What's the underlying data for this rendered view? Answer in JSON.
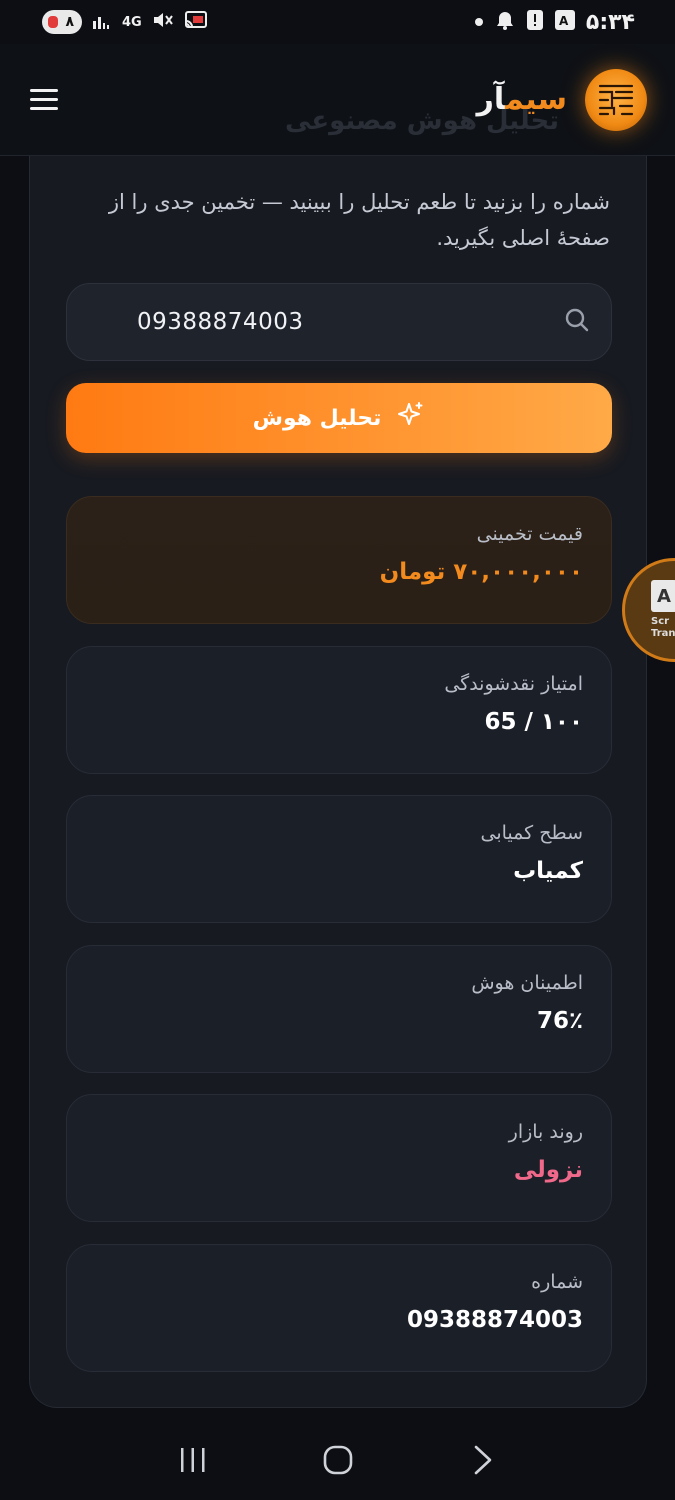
{
  "status_bar": {
    "battery_level": "۸",
    "network_type": "4G",
    "time": "۵:۳۴",
    "icons": [
      "signal-icon",
      "mute-icon",
      "cast-icon",
      "dot-icon",
      "alarm-icon",
      "alert-icon",
      "translate-icon"
    ]
  },
  "header": {
    "brand_part1": "سیم",
    "brand_part2": "آر",
    "ghost_title": "تحلیل هوش مصنوعی",
    "logo_icon": "circuit-chip-icon",
    "menu_icon": "hamburger-menu-icon"
  },
  "intro": {
    "text": "شماره را بزنید تا طعم تحلیل را ببینید — تخمین جدی را از صفحهٔ اصلی بگیرید."
  },
  "search": {
    "value": "09388874003",
    "icon": "search-icon"
  },
  "analyze_button": {
    "label": "تحلیل هوش",
    "icon": "sparkle-icon"
  },
  "results": {
    "price": {
      "label": "قیمت تخمینی",
      "value": "۷۰,۰۰۰,۰۰۰ تومان"
    },
    "liquidity": {
      "label": "امتیاز نقدشوندگی",
      "value": "65 / ۱۰۰"
    },
    "rarity": {
      "label": "سطح کمیابی",
      "value": "کمیاب"
    },
    "confidence": {
      "label": "اطمینان هوش",
      "value": "76٪"
    },
    "trend": {
      "label": "روند بازار",
      "value": "نزولی"
    },
    "number": {
      "label": "شماره",
      "value": "09388874003"
    }
  },
  "float_widget": {
    "letter": "A",
    "text_line1": "Scr",
    "text_line2": "Trans"
  },
  "colors": {
    "accent": "#f28a1e",
    "trend_down": "#f0688a",
    "background": "#0c0e13",
    "card": "#1b1f28"
  }
}
